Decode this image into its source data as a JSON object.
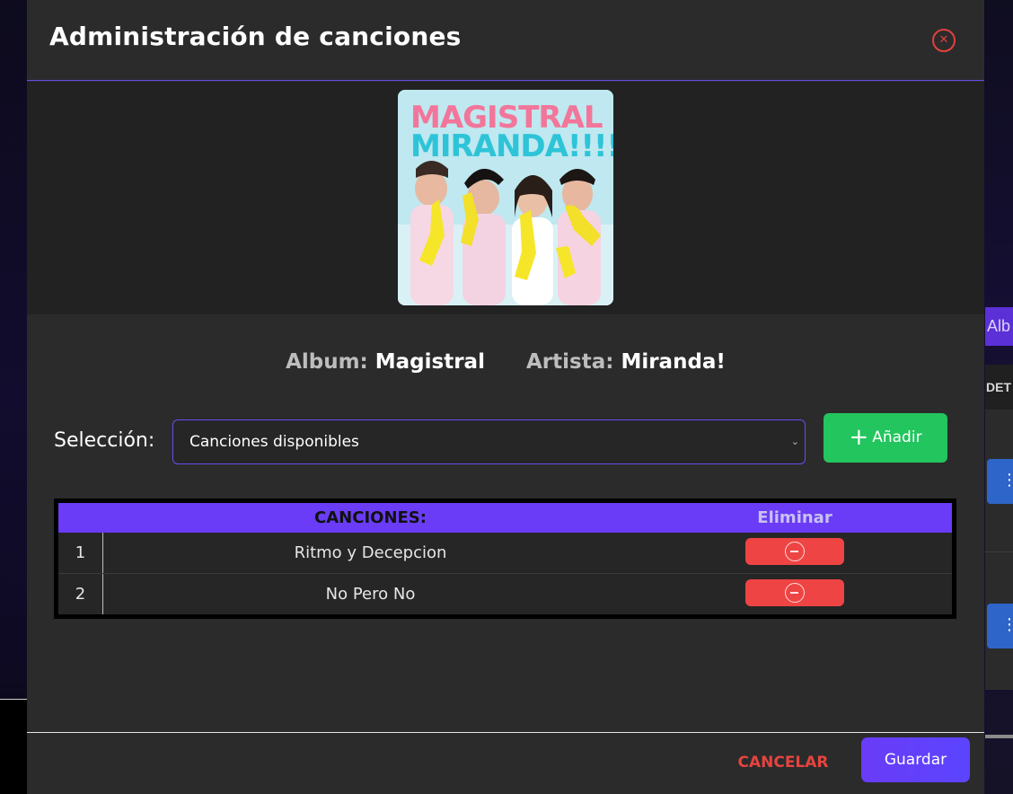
{
  "modal": {
    "title": "Administración de canciones",
    "close_icon": "x-circle-icon"
  },
  "album": {
    "cover_alt": "Magistral album cover",
    "cover_line1": "MAGISTRAL",
    "cover_line2": "MIRANDA!!!!",
    "album_label": "Album:",
    "album_name": "Magistral",
    "artist_label": "Artista:",
    "artist_name": "Miranda!"
  },
  "selection": {
    "label": "Selección:",
    "selected_value": "Canciones disponibles",
    "add_label": "Añadir",
    "add_icon": "plus-icon"
  },
  "songs_table": {
    "headers": [
      "CANCIONES:",
      "Eliminar"
    ],
    "rows": [
      {
        "index": "1",
        "name": "Ritmo y Decepcion"
      },
      {
        "index": "2",
        "name": "No Pero No"
      }
    ],
    "delete_icon": "minus-circle-icon"
  },
  "footer": {
    "cancel_label": "CANCELAR",
    "save_label": "Guardar"
  },
  "background": {
    "right_tab_text": "Alb",
    "right_head_text": "DET",
    "right_button_icon": "kebab-menu-icon"
  },
  "colors": {
    "accent": "#6a3cf7",
    "add_green": "#22c55e",
    "delete_red": "#ef4444",
    "cancel_red": "#e5443f"
  }
}
